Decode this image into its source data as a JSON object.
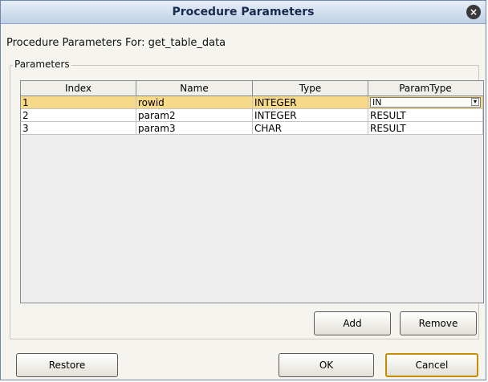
{
  "dialog": {
    "title": "Procedure Parameters",
    "subtitle": "Procedure Parameters For: get_table_data",
    "group_label": "Parameters"
  },
  "table": {
    "headers": [
      "Index",
      "Name",
      "Type",
      "ParamType"
    ],
    "rows": [
      {
        "index": "1",
        "name": "rowid",
        "type": "INTEGER",
        "paramtype": "IN",
        "selected": true
      },
      {
        "index": "2",
        "name": "param2",
        "type": "INTEGER",
        "paramtype": "RESULT",
        "selected": false
      },
      {
        "index": "3",
        "name": "param3",
        "type": "CHAR",
        "paramtype": "RESULT",
        "selected": false
      }
    ]
  },
  "buttons": {
    "add": "Add",
    "remove": "Remove",
    "restore": "Restore",
    "ok": "OK",
    "cancel": "Cancel"
  },
  "colors": {
    "selected_row": "#f6d989",
    "title_bar": "#bfd1e6",
    "default_button_border": "#c98b00"
  },
  "icons": {
    "close": "close-icon",
    "dropdown": "dropdown-arrow-icon"
  }
}
